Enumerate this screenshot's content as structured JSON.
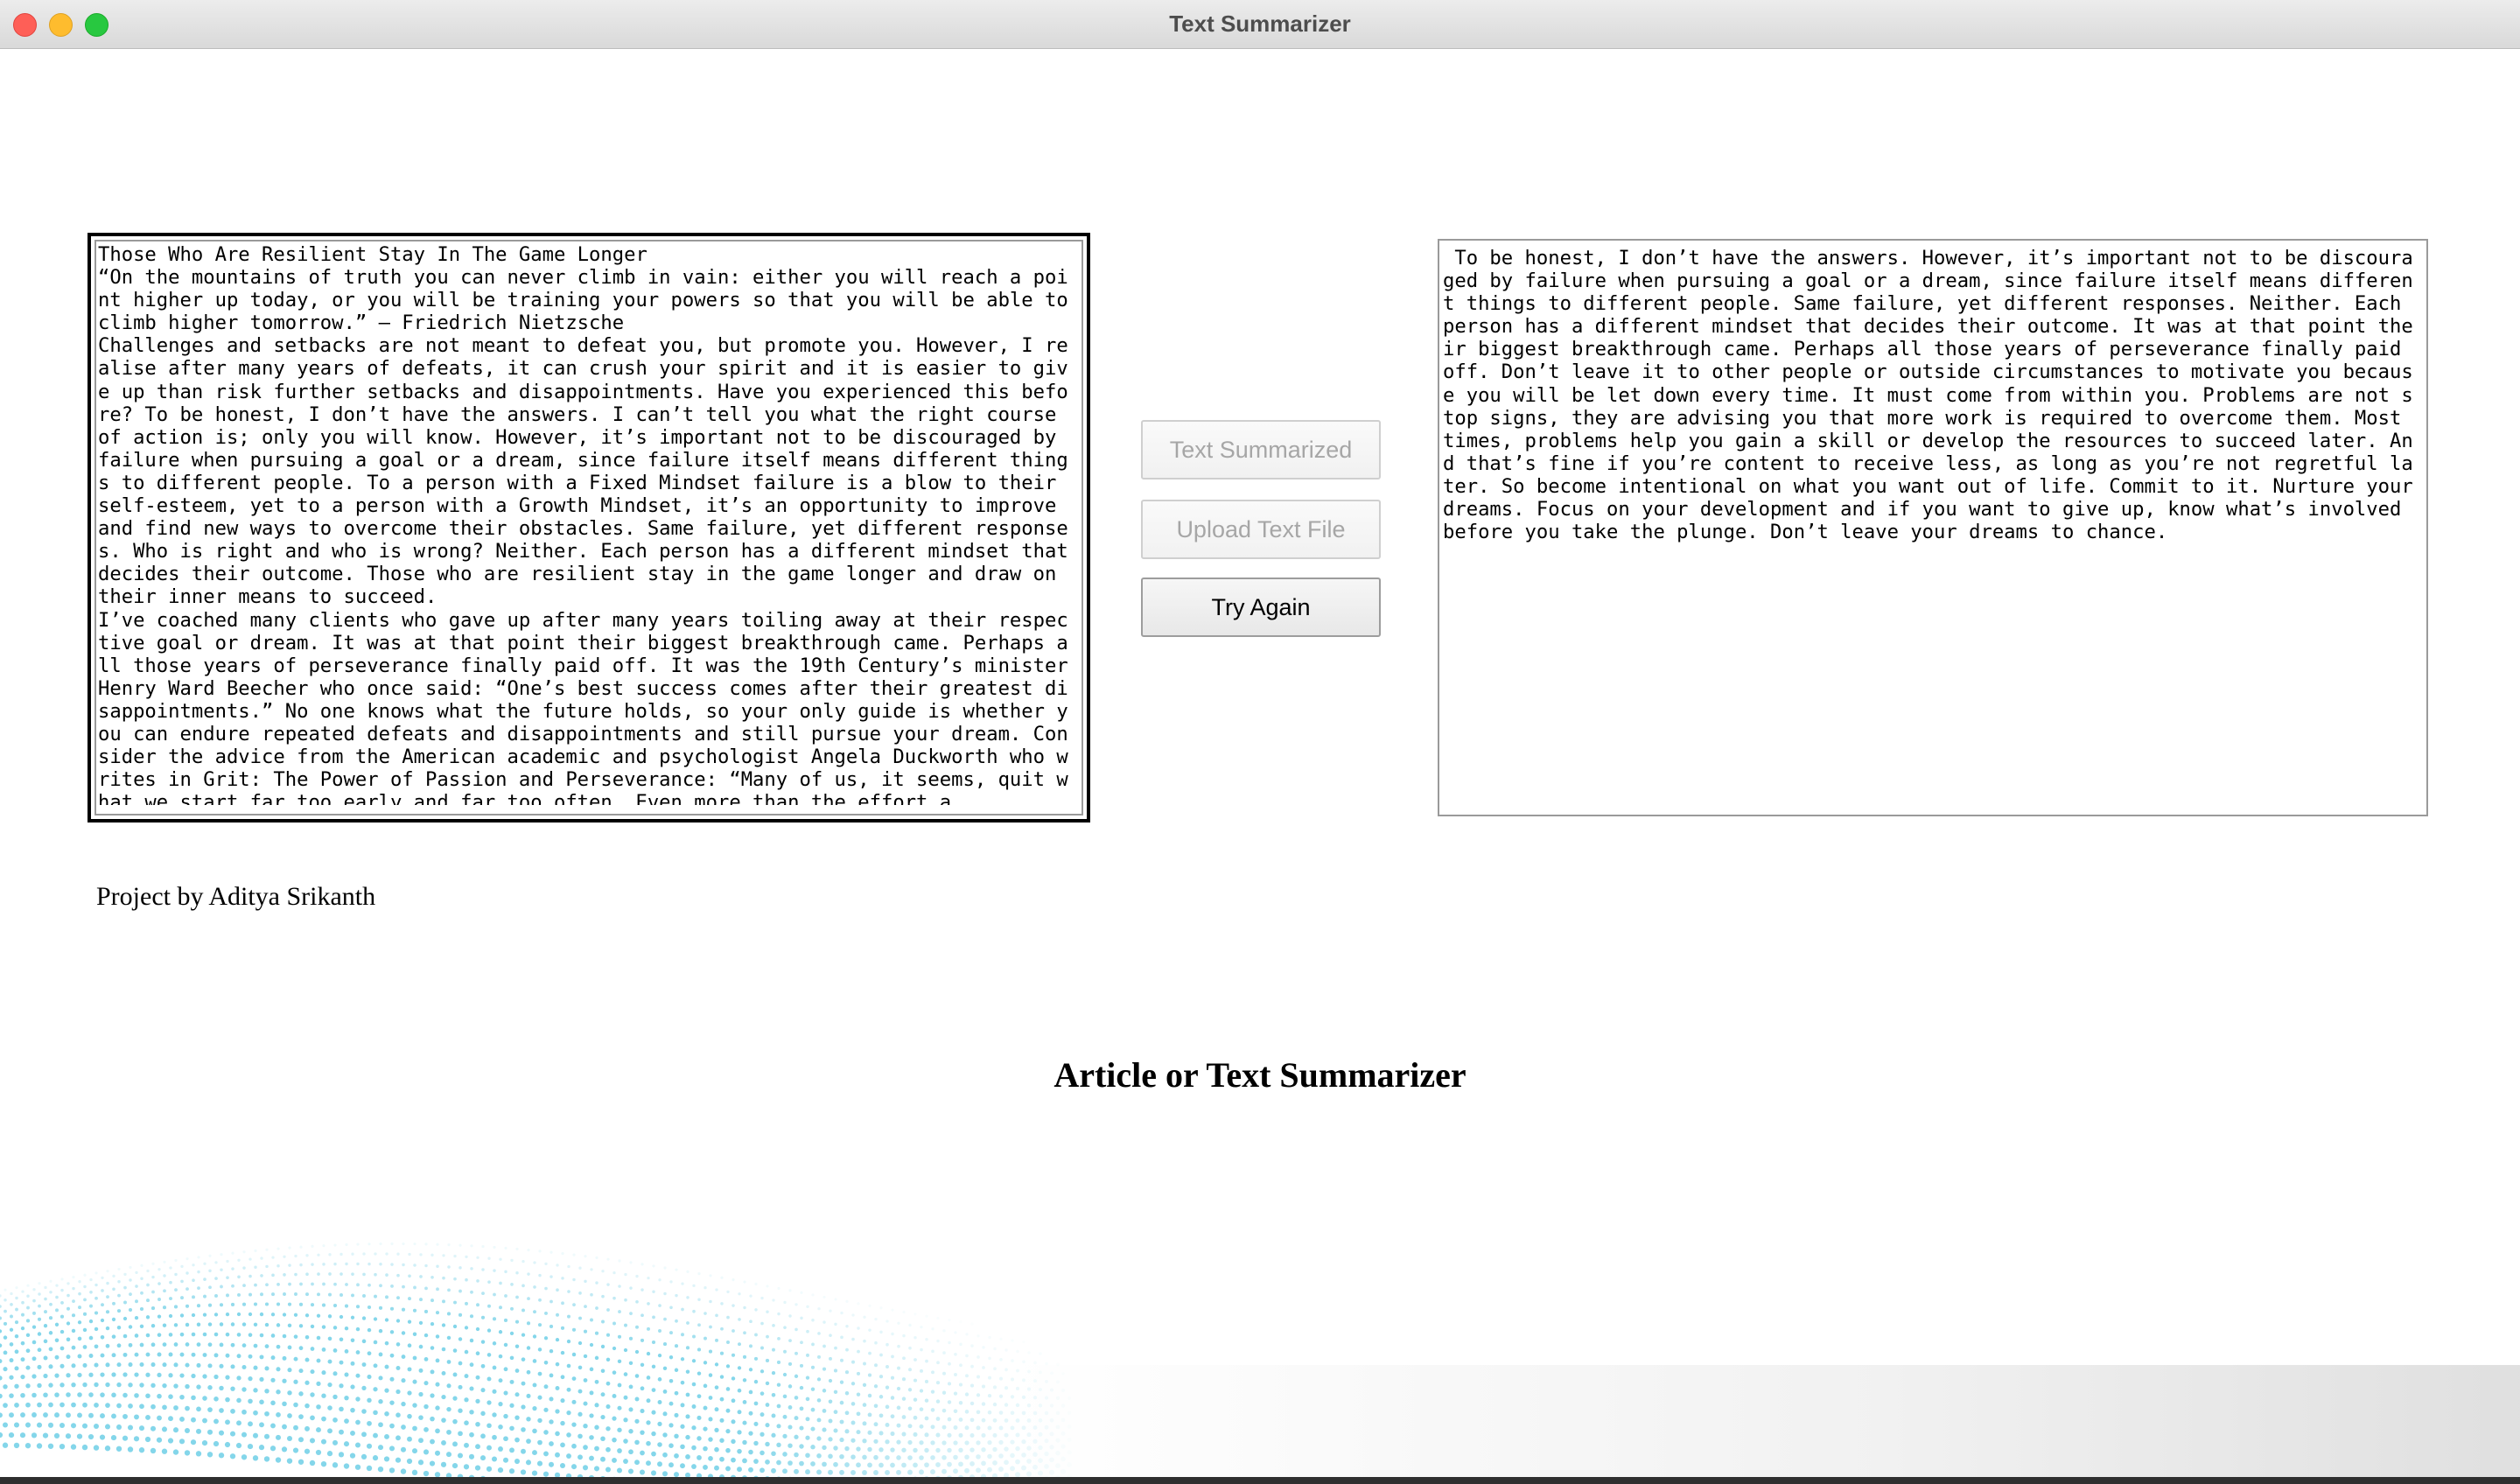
{
  "window": {
    "title": "Text Summarizer"
  },
  "input": {
    "text": "Those Who Are Resilient Stay In The Game Longer\n“On the mountains of truth you can never climb in vain: either you will reach a point higher up today, or you will be training your powers so that you will be able to climb higher tomorrow.” — Friedrich Nietzsche\nChallenges and setbacks are not meant to defeat you, but promote you. However, I realise after many years of defeats, it can crush your spirit and it is easier to give up than risk further setbacks and disappointments. Have you experienced this before? To be honest, I don’t have the answers. I can’t tell you what the right course of action is; only you will know. However, it’s important not to be discouraged by failure when pursuing a goal or a dream, since failure itself means different things to different people. To a person with a Fixed Mindset failure is a blow to their self-esteem, yet to a person with a Growth Mindset, it’s an opportunity to improve and find new ways to overcome their obstacles. Same failure, yet different responses. Who is right and who is wrong? Neither. Each person has a different mindset that decides their outcome. Those who are resilient stay in the game longer and draw on their inner means to succeed.\nI’ve coached many clients who gave up after many years toiling away at their respective goal or dream. It was at that point their biggest breakthrough came. Perhaps all those years of perseverance finally paid off. It was the 19th Century’s minister Henry Ward Beecher who once said: “One’s best success comes after their greatest disappointments.” No one knows what the future holds, so your only guide is whether you can endure repeated defeats and disappointments and still pursue your dream. Consider the advice from the American academic and psychologist Angela Duckworth who writes in Grit: The Power of Passion and Perseverance: “Many of us, it seems, quit what we start far too early and far too often. Even more than the effort a"
  },
  "output": {
    "text": " To be honest, I don’t have the answers. However, it’s important not to be discouraged by failure when pursuing a goal or a dream, since failure itself means different things to different people. Same failure, yet different responses. Neither. Each person has a different mindset that decides their outcome. It was at that point their biggest breakthrough came. Perhaps all those years of perseverance finally paid off. Don’t leave it to other people or outside circumstances to motivate you because you will be let down every time. It must come from within you. Problems are not stop signs, they are advising you that more work is required to overcome them. Most times, problems help you gain a skill or develop the resources to succeed later. And that’s fine if you’re content to receive less, as long as you’re not regretful later. So become intentional on what you want out of life. Commit to it. Nurture your dreams. Focus on your development and if you want to give up, know what’s involved before you take the plunge. Don’t leave your dreams to chance."
  },
  "buttons": {
    "summarize_label": "Text Summarized",
    "upload_label": "Upload Text File",
    "try_again_label": "Try Again"
  },
  "footer": {
    "credit": "Project by Aditya Srikanth",
    "heading": "Article or Text Summarizer"
  },
  "colors": {
    "close": "#fe5f57",
    "minimize": "#febc2e",
    "zoom": "#28c840",
    "wave": "#1fb4d8"
  }
}
